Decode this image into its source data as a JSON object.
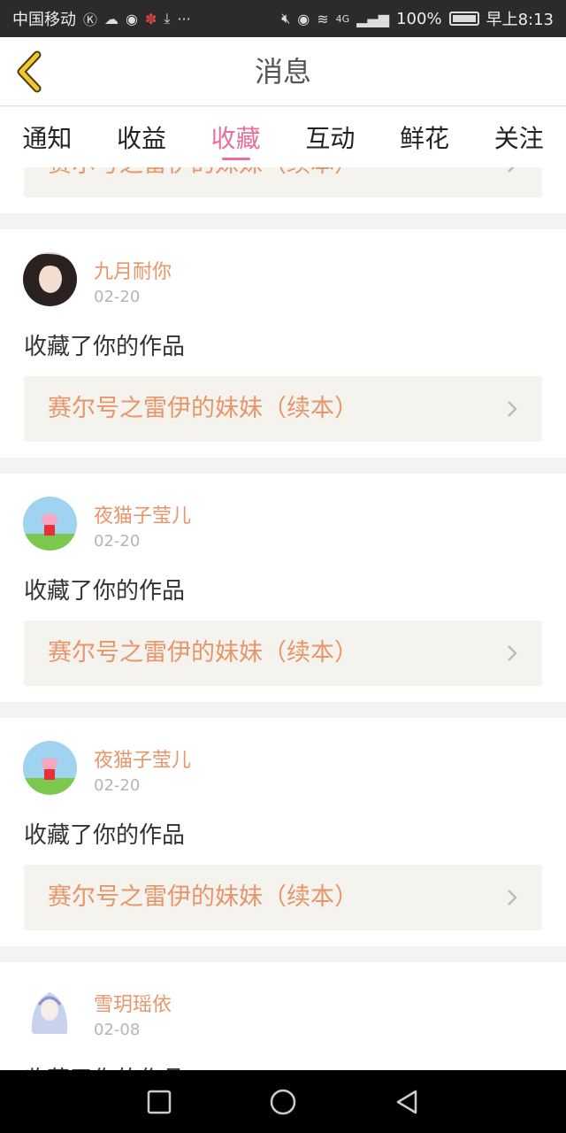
{
  "status_bar": {
    "carrier": "中国移动",
    "notif_icons": [
      "k-icon",
      "weibo-icon",
      "app-icon",
      "star-icon",
      "download-icon",
      "more-icon"
    ],
    "battery": "100%",
    "time": "早上8:13",
    "net": "4G"
  },
  "header": {
    "title": "消息"
  },
  "tabs": [
    {
      "label": "通知",
      "active": false
    },
    {
      "label": "收益",
      "active": false
    },
    {
      "label": "收藏",
      "active": true
    },
    {
      "label": "互动",
      "active": false
    },
    {
      "label": "鲜花",
      "active": false
    },
    {
      "label": "关注",
      "active": false
    }
  ],
  "partial_top_card": {
    "work_title": "赛尔号之雷伊的妹妹（续本）"
  },
  "items": [
    {
      "username": "九月耐你",
      "date": "02-20",
      "action": "收藏了你的作品",
      "work_title": "赛尔号之雷伊的妹妹（续本）",
      "avatar": "girl-avatar"
    },
    {
      "username": "夜猫子莹儿",
      "date": "02-20",
      "action": "收藏了你的作品",
      "work_title": "赛尔号之雷伊的妹妹（续本）",
      "avatar": "peppa-avatar"
    },
    {
      "username": "夜猫子莹儿",
      "date": "02-20",
      "action": "收藏了你的作品",
      "work_title": "赛尔号之雷伊的妹妹（续本）",
      "avatar": "peppa-avatar"
    },
    {
      "username": "雪玥瑶依",
      "date": "02-08",
      "action": "收藏了你的作品",
      "avatar": "anime-avatar"
    }
  ],
  "colors": {
    "accent": "#e8709a",
    "orange_text": "#e8956a",
    "work_bg": "#f4f3ee"
  }
}
